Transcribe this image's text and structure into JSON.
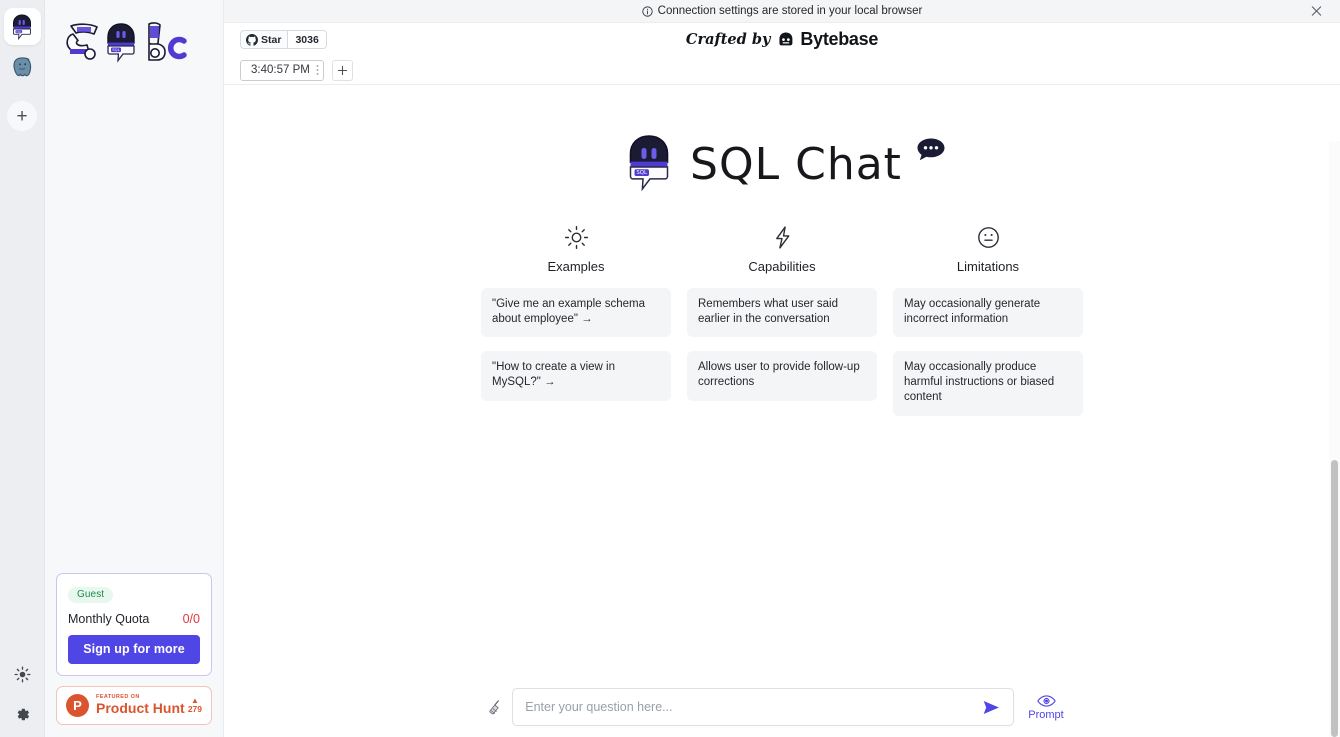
{
  "notice": {
    "text": "Connection settings are stored in your local browser",
    "info_icon": "info-circle-icon",
    "close_icon": "close-icon"
  },
  "header": {
    "github_star_label": "Star",
    "github_star_count": "3036",
    "github_icon": "github-icon",
    "crafted_by": "Crafted by",
    "brand": "Bytebase",
    "brand_icon": "bytebase-logo-icon"
  },
  "tabs": {
    "items": [
      {
        "label": "3:40:57 PM",
        "menu_icon": "kebab-menu-icon",
        "active": true
      }
    ],
    "add_label": "+",
    "add_icon": "plus-icon"
  },
  "rail": {
    "connections": [
      {
        "name": "sql-chat-connection",
        "icon": "sqlchat-robot-icon",
        "active": true
      },
      {
        "name": "postgres-connection",
        "icon": "postgresql-elephant-icon",
        "active": false
      }
    ],
    "add_icon": "plus-icon",
    "theme_icon": "sun-icon",
    "settings_icon": "gear-icon"
  },
  "sidebar": {
    "logo_icon": "sqlchat-wordmark-icon",
    "quota": {
      "badge": "Guest",
      "label": "Monthly Quota",
      "value": "0/0",
      "cta": "Sign up for more"
    },
    "product_hunt": {
      "featured_on": "FEATURED ON",
      "name": "Product Hunt",
      "upvotes": "279",
      "caret": "▲",
      "logo_icon": "product-hunt-icon"
    }
  },
  "hero": {
    "logo_icon": "sqlchat-robot-icon",
    "title": "SQL Chat",
    "bubble_icon": "chat-bubble-icon"
  },
  "columns": [
    {
      "icon": "sun-icon",
      "title": "Examples",
      "cards": [
        {
          "text": "\"Give me an example schema about employee\" →",
          "clickable": true
        },
        {
          "text": "\"How to create a view in MySQL?\" →",
          "clickable": true
        }
      ]
    },
    {
      "icon": "lightning-bolt-icon",
      "title": "Capabilities",
      "cards": [
        {
          "text": "Remembers what user said earlier in the conversation",
          "clickable": false
        },
        {
          "text": "Allows user to provide follow-up corrections",
          "clickable": false
        }
      ]
    },
    {
      "icon": "neutral-face-icon",
      "title": "Limitations",
      "cards": [
        {
          "text": "May occasionally generate incorrect information",
          "clickable": false
        },
        {
          "text": "May occasionally produce harmful instructions or biased content",
          "clickable": false
        }
      ]
    }
  ],
  "input": {
    "placeholder": "Enter your question here...",
    "value": "",
    "clear_icon": "broom-icon",
    "send_icon": "send-icon",
    "prompt_icon": "eye-icon",
    "prompt_label": "Prompt"
  },
  "colors": {
    "accent": "#4f46e5",
    "danger": "#e0383e",
    "product_hunt": "#da552f",
    "guest_badge_text": "#1e8a4c",
    "guest_badge_bg": "#e8f8ee"
  }
}
